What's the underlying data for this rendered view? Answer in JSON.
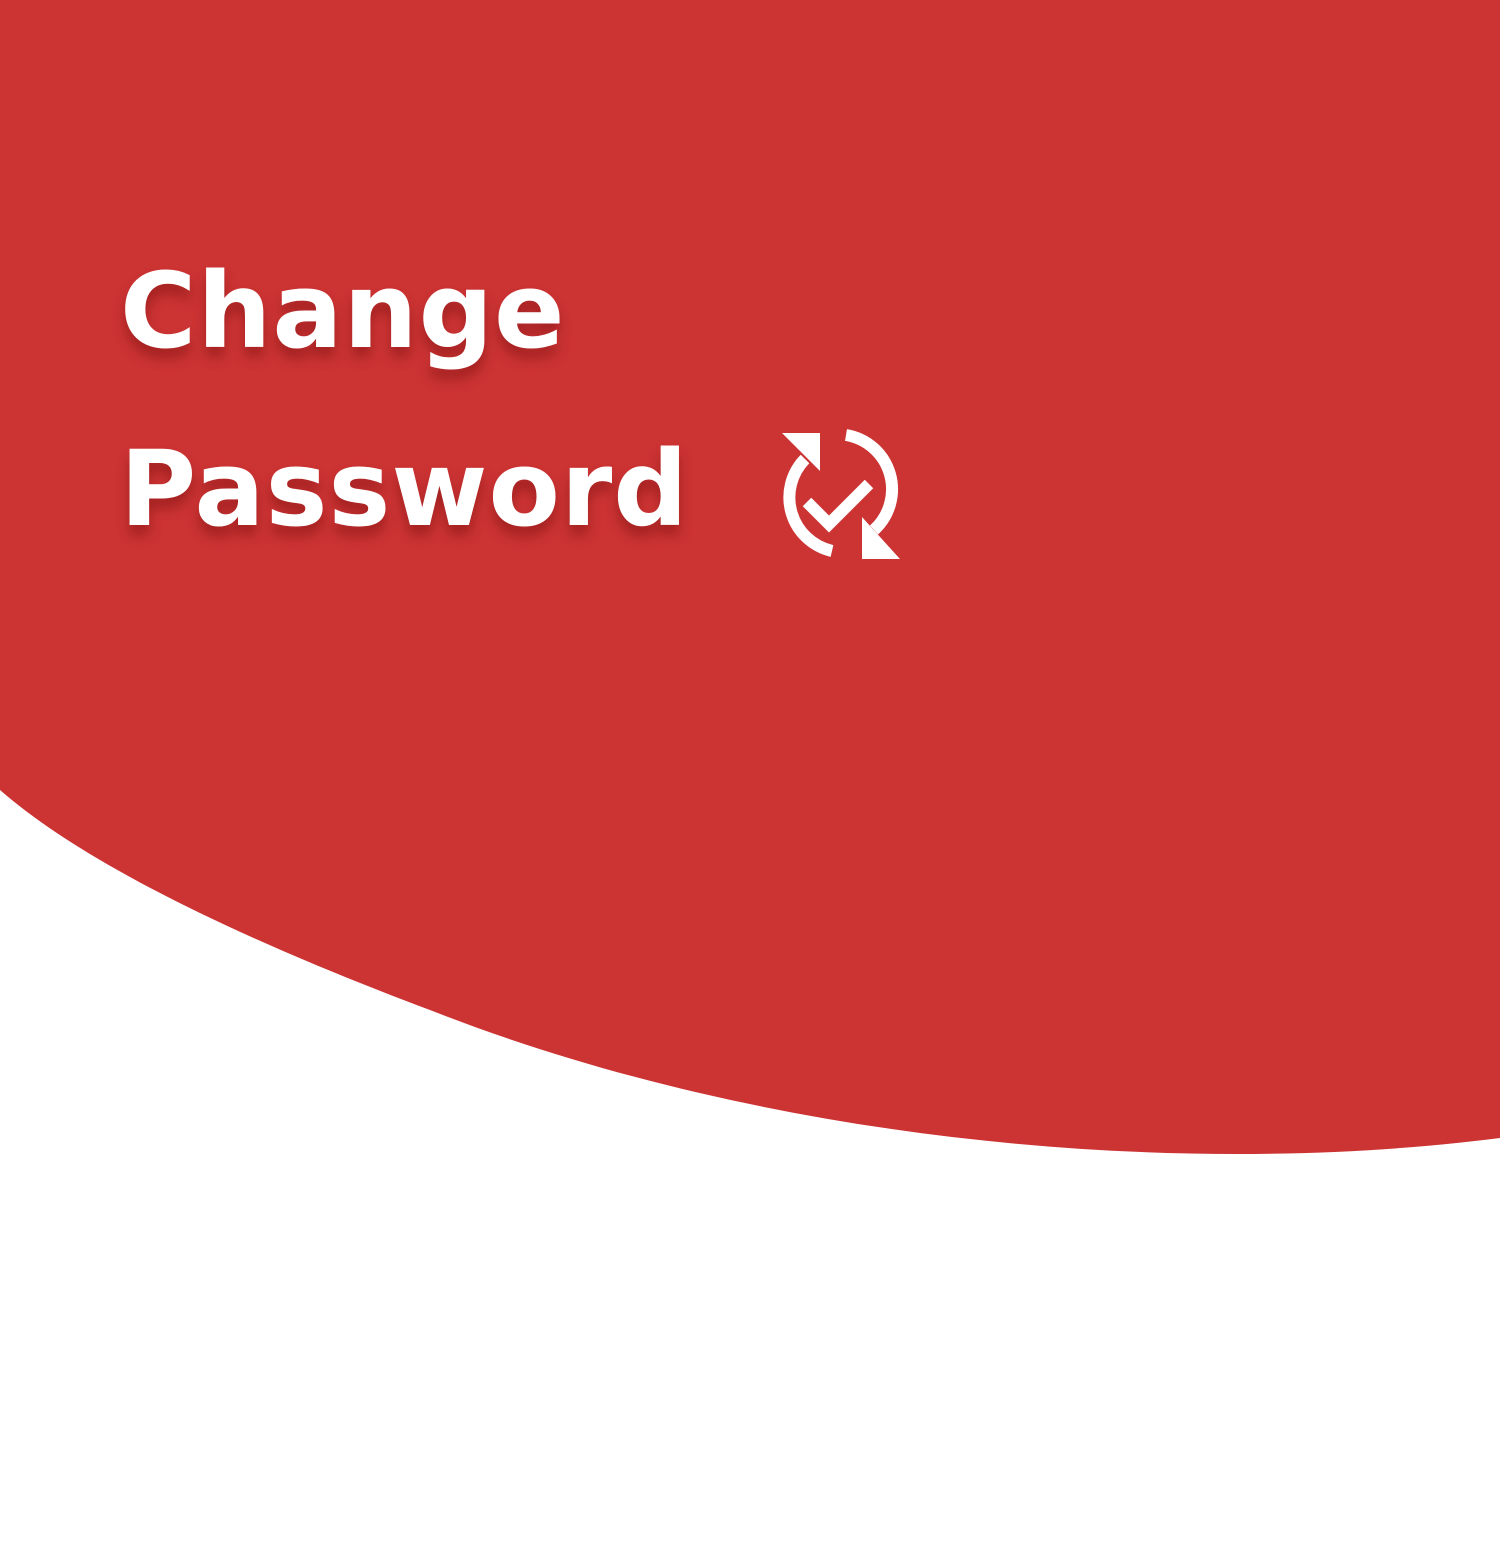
{
  "header": {
    "title_line_1": "Change",
    "title_line_2": "Password",
    "icon": "sync-check-icon"
  },
  "colors": {
    "accent": "#CC3333",
    "background": "#FFFFFF",
    "title_text": "#FFFFFF"
  }
}
